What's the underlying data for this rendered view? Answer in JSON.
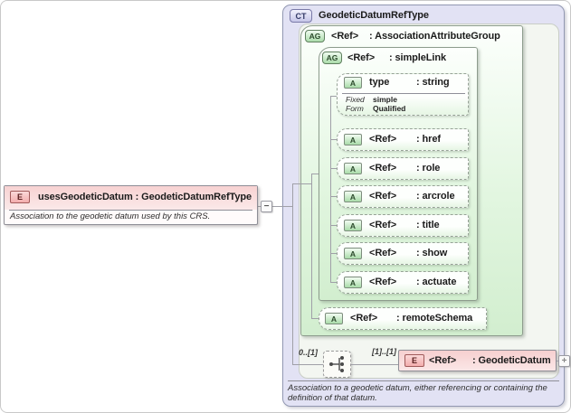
{
  "source_element": {
    "icon": "E",
    "title": "usesGeodeticDatum : GeodeticDatumRefType",
    "annotation": "Association to the geodetic datum used by this CRS.",
    "collapse_button": "−"
  },
  "complex_type": {
    "icon": "CT",
    "title": "GeodeticDatumRefType",
    "annotation": "Association to a geodetic datum, either referencing or containing the definition of that datum.",
    "attribute_group": {
      "icon": "AG",
      "name": "<Ref>",
      "type": ": AssociationAttributeGroup",
      "simple_link": {
        "icon": "AG",
        "name": "<Ref>",
        "type": ": simpleLink",
        "type_attribute": {
          "icon": "A",
          "name": "type",
          "type": ": string",
          "facets": [
            {
              "label": "Fixed",
              "value": "simple"
            },
            {
              "label": "Form",
              "value": "Qualified"
            }
          ]
        },
        "ref_attributes": [
          {
            "icon": "A",
            "name": "<Ref>",
            "type": ": href"
          },
          {
            "icon": "A",
            "name": "<Ref>",
            "type": ": role"
          },
          {
            "icon": "A",
            "name": "<Ref>",
            "type": ": arcrole"
          },
          {
            "icon": "A",
            "name": "<Ref>",
            "type": ": title"
          },
          {
            "icon": "A",
            "name": "<Ref>",
            "type": ": show"
          },
          {
            "icon": "A",
            "name": "<Ref>",
            "type": ": actuate"
          }
        ]
      },
      "remote_schema": {
        "icon": "A",
        "name": "<Ref>",
        "type": ": remoteSchema"
      }
    },
    "sequence": {
      "occurrence_before": "0..[1]",
      "occurrence_after": "[1]..[1]",
      "element": {
        "icon": "E",
        "name": "<Ref>",
        "type": ": GeodeticDatum"
      },
      "expand_button": "+"
    }
  }
}
